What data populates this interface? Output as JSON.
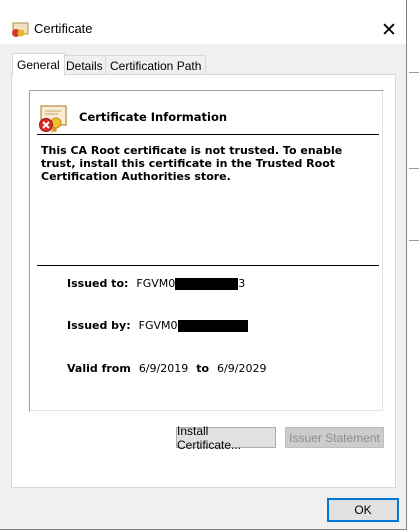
{
  "window": {
    "title": "Certificate",
    "close_glyph": "✕"
  },
  "tabs": [
    {
      "label": "General",
      "active": true
    },
    {
      "label": "Details",
      "active": false
    },
    {
      "label": "Certification Path",
      "active": false
    }
  ],
  "info": {
    "heading": "Certificate Information",
    "warning": "This CA Root certificate is not trusted. To enable trust, install this certificate in the Trusted Root Certification Authorities store."
  },
  "fields": {
    "issued_to_label": "Issued to:",
    "issued_to_value": "FGVM0",
    "issued_to_tail": "3",
    "issued_by_label": "Issued by:",
    "issued_by_value": "FGVM0",
    "valid_from_label": "Valid from",
    "valid_from_value": "6/9/2019",
    "valid_to_label": "to",
    "valid_to_value": "6/9/2029"
  },
  "buttons": {
    "install": "Install Certificate...",
    "issuer_statement": "Issuer Statement",
    "ok": "OK"
  },
  "colors": {
    "accent": "#0078d7",
    "window_bg": "#f0f0f0"
  }
}
